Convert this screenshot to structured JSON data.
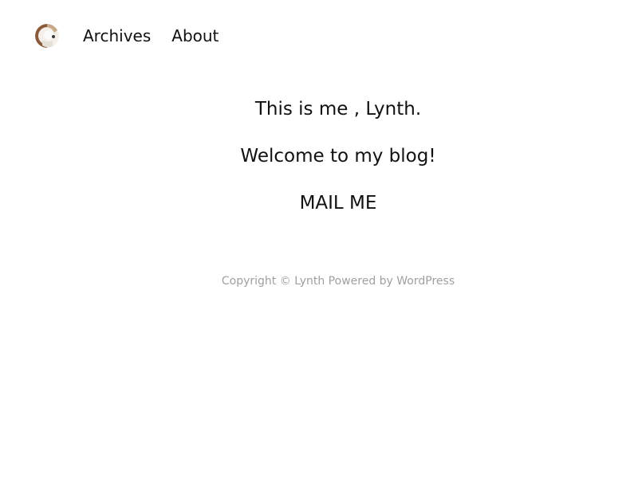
{
  "header": {
    "nav": [
      {
        "label": "Archives"
      },
      {
        "label": "About"
      }
    ]
  },
  "main": {
    "line1": "This is me , Lynth.",
    "line2": "Welcome to my blog!",
    "mail_link": "MAIL ME"
  },
  "footer": {
    "copyright": "Copyright © Lynth Powered by WordPress"
  },
  "colors": {
    "text": "#111111",
    "footer_text": "#a0a0a0",
    "background": "#ffffff"
  }
}
